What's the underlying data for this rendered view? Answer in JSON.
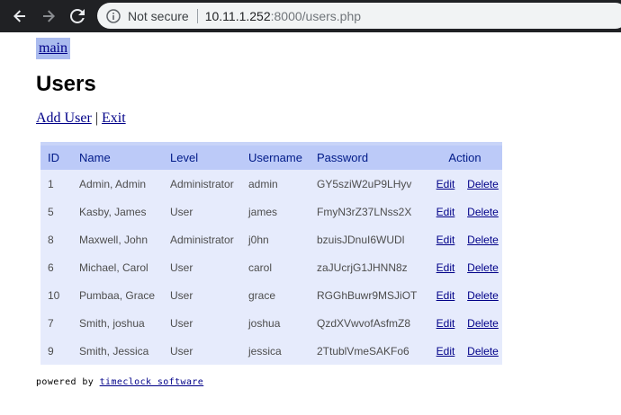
{
  "browser": {
    "security_label": "Not secure",
    "url_host": "10.11.1.252",
    "url_rest": ":8000/users.php"
  },
  "page": {
    "main_link": "main",
    "title": "Users",
    "add_user": "Add User",
    "separator": "|",
    "exit": "Exit"
  },
  "table": {
    "headers": {
      "id": "ID",
      "name": "Name",
      "level": "Level",
      "username": "Username",
      "password": "Password",
      "action": "Action"
    },
    "edit_label": "Edit",
    "delete_label": "Delete",
    "rows": [
      {
        "id": "1",
        "name": "Admin, Admin",
        "level": "Administrator",
        "username": "admin",
        "password": "GY5sziW2uP9LHyv"
      },
      {
        "id": "5",
        "name": "Kasby, James",
        "level": "User",
        "username": "james",
        "password": "FmyN3rZ37LNss2X"
      },
      {
        "id": "8",
        "name": "Maxwell, John",
        "level": "Administrator",
        "username": "j0hn",
        "password": "bzuisJDnuI6WUDl"
      },
      {
        "id": "6",
        "name": "Michael, Carol",
        "level": "User",
        "username": "carol",
        "password": "zaJUcrjG1JHNN8z"
      },
      {
        "id": "10",
        "name": "Pumbaa, Grace",
        "level": "User",
        "username": "grace",
        "password": "RGGhBuwr9MSJiOT"
      },
      {
        "id": "7",
        "name": "Smith, joshua",
        "level": "User",
        "username": "joshua",
        "password": "QzdXVwvofAsfmZ8"
      },
      {
        "id": "9",
        "name": "Smith, Jessica",
        "level": "User",
        "username": "jessica",
        "password": "2TtublVmeSAKFo6"
      }
    ]
  },
  "footer": {
    "prefix": "powered by",
    "link": "timeclock software"
  }
}
